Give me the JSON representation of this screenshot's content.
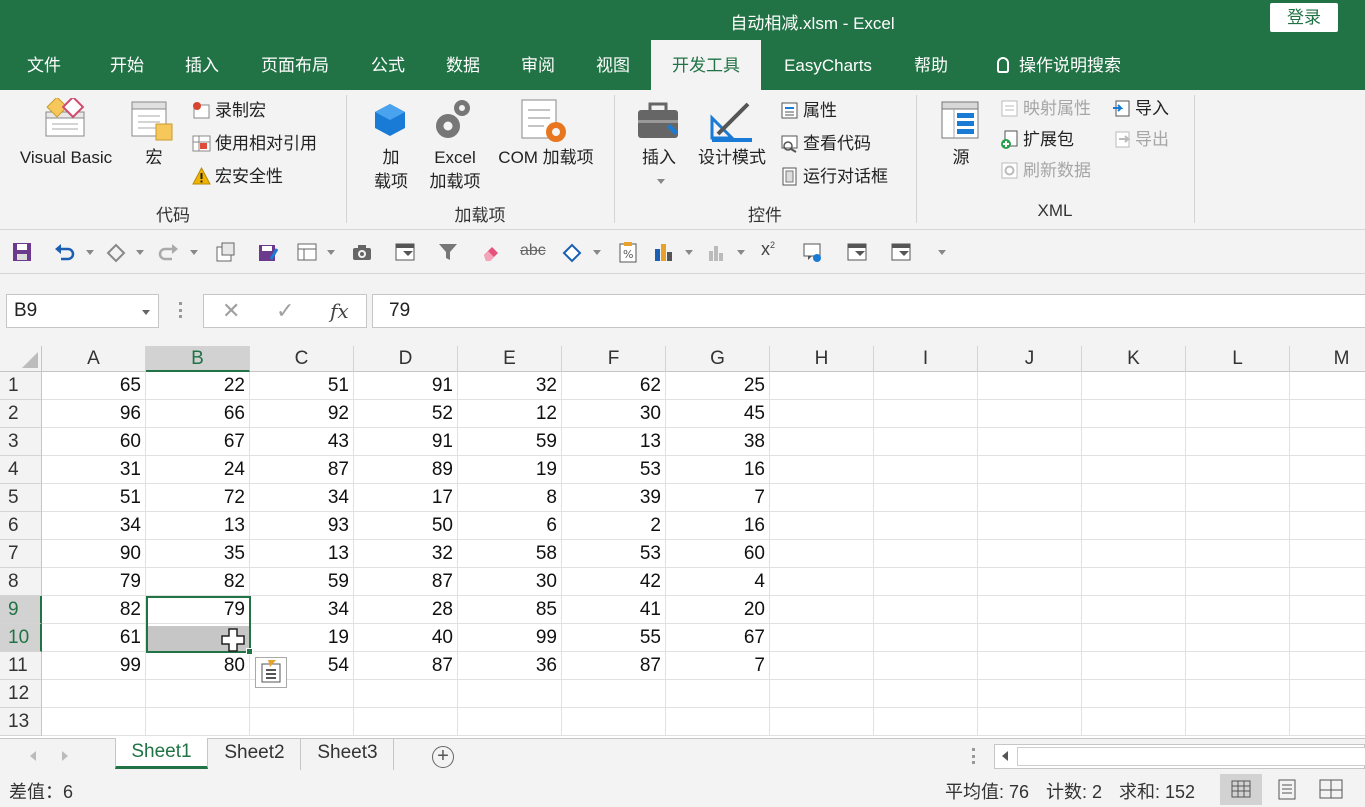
{
  "window": {
    "title": "自动相减.xlsm  -  Excel",
    "login": "登录"
  },
  "tabs": [
    {
      "label": "文件"
    },
    {
      "label": "开始"
    },
    {
      "label": "插入"
    },
    {
      "label": "页面布局"
    },
    {
      "label": "公式"
    },
    {
      "label": "数据"
    },
    {
      "label": "审阅"
    },
    {
      "label": "视图"
    },
    {
      "label": "开发工具"
    },
    {
      "label": "EasyCharts"
    },
    {
      "label": "帮助"
    },
    {
      "label": "操作说明搜索"
    }
  ],
  "ribbon": {
    "code": {
      "label": "代码",
      "visual_basic": "Visual Basic",
      "macros": "宏",
      "record_macro": "录制宏",
      "relative_ref": "使用相对引用",
      "macro_security": "宏安全性"
    },
    "addins": {
      "label": "加载项",
      "addin_line1": "加",
      "addin_line2": "载项",
      "excel_line1": "Excel",
      "excel_line2": "加载项",
      "com": "COM 加载项"
    },
    "controls": {
      "label": "控件",
      "insert": "插入",
      "design_mode": "设计模式",
      "properties": "属性",
      "view_code": "查看代码",
      "run_dialog": "运行对话框"
    },
    "xml": {
      "label": "XML",
      "source": "源",
      "map_props": "映射属性",
      "expansion": "扩展包",
      "refresh": "刷新数据",
      "import": "导入",
      "export": "导出"
    }
  },
  "formula_bar": {
    "name_box": "B9",
    "cancel": "✕",
    "enter": "✓",
    "fx": "fx",
    "value": "79"
  },
  "columns": [
    "A",
    "B",
    "C",
    "D",
    "E",
    "F",
    "G",
    "H",
    "I",
    "J",
    "K",
    "L",
    "M"
  ],
  "rows": [
    {
      "n": "1",
      "v": [
        "65",
        "22",
        "51",
        "91",
        "32",
        "62",
        "25"
      ]
    },
    {
      "n": "2",
      "v": [
        "96",
        "66",
        "92",
        "52",
        "12",
        "30",
        "45"
      ]
    },
    {
      "n": "3",
      "v": [
        "60",
        "67",
        "43",
        "91",
        "59",
        "13",
        "38"
      ]
    },
    {
      "n": "4",
      "v": [
        "31",
        "24",
        "87",
        "89",
        "19",
        "53",
        "16"
      ]
    },
    {
      "n": "5",
      "v": [
        "51",
        "72",
        "34",
        "17",
        "8",
        "39",
        "7"
      ]
    },
    {
      "n": "6",
      "v": [
        "34",
        "13",
        "93",
        "50",
        "6",
        "2",
        "16"
      ]
    },
    {
      "n": "7",
      "v": [
        "90",
        "35",
        "13",
        "32",
        "58",
        "53",
        "60"
      ]
    },
    {
      "n": "8",
      "v": [
        "79",
        "82",
        "59",
        "87",
        "30",
        "42",
        "4"
      ]
    },
    {
      "n": "9",
      "v": [
        "82",
        "79",
        "34",
        "28",
        "85",
        "41",
        "20"
      ]
    },
    {
      "n": "10",
      "v": [
        "61",
        "",
        "19",
        "40",
        "99",
        "55",
        "67"
      ]
    },
    {
      "n": "11",
      "v": [
        "99",
        "80",
        "54",
        "87",
        "36",
        "87",
        "7"
      ]
    },
    {
      "n": "12",
      "v": [
        "",
        "",
        "",
        "",
        "",
        "",
        ""
      ]
    },
    {
      "n": "13",
      "v": [
        "",
        "",
        "",
        "",
        "",
        "",
        ""
      ]
    }
  ],
  "sheets": [
    "Sheet1",
    "Sheet2",
    "Sheet3"
  ],
  "status": {
    "left": "差值：6",
    "average": "平均值: 76",
    "count": "计数: 2",
    "sum": "求和: 152"
  },
  "colors": {
    "accent": "#217346"
  }
}
